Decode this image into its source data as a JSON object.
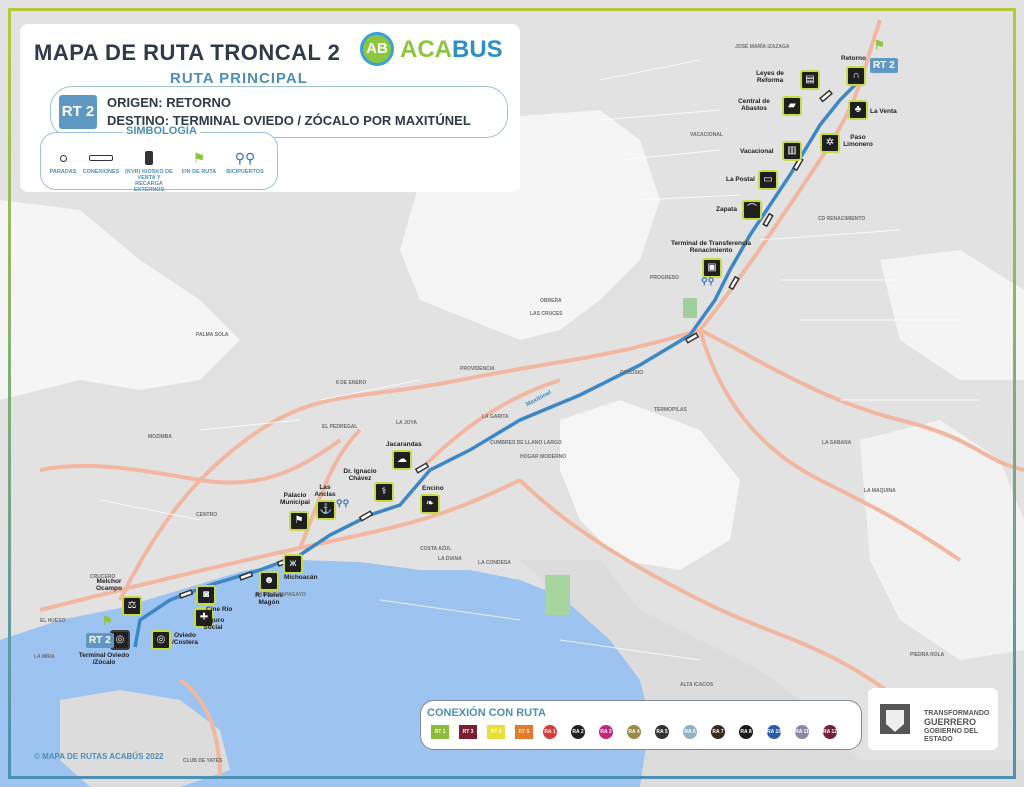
{
  "header": {
    "title": "MAPA DE RUTA TRONCAL 2",
    "logo_mark": "AB",
    "logo_text_a": "ACA",
    "logo_text_b": "BUS",
    "subtitle": "RUTA PRINCIPAL"
  },
  "route": {
    "badge": "RT 2",
    "origin": "ORIGEN: RETORNO",
    "destination": "DESTINO: TERMINAL OVIEDO / ZÓCALO POR MAXITÚNEL"
  },
  "legend": {
    "title": "SIMBOLOGÍA",
    "items": [
      {
        "icon": "stop-dot-icon",
        "label": "PARADAS"
      },
      {
        "icon": "connection-bar-icon",
        "label": "CONEXIONES"
      },
      {
        "icon": "kiosk-icon",
        "label": "(KVR) KIOSKO DE VENTA Y RECARGA EXTERNOS"
      },
      {
        "icon": "flag-icon",
        "label": "FIN DE RUTA"
      },
      {
        "icon": "bicycle-icon",
        "label": "BICIPUERTOS"
      }
    ]
  },
  "stops": [
    {
      "name": "Retorno",
      "icon": "retorno-icon"
    },
    {
      "name": "Leyes de Reforma",
      "icon": "book-icon"
    },
    {
      "name": "Central de Abastos",
      "icon": "truck-icon"
    },
    {
      "name": "La Venta",
      "icon": "tree-icon"
    },
    {
      "name": "Paso Limonero",
      "icon": "wheel-icon"
    },
    {
      "name": "Vacacional",
      "icon": "luggage-icon"
    },
    {
      "name": "La Postal",
      "icon": "postcard-icon"
    },
    {
      "name": "Zapata",
      "icon": "hat-icon"
    },
    {
      "name": "Terminal de Transferencia Renacimiento",
      "icon": "bus-terminal-icon"
    },
    {
      "name": "Jacarandas",
      "icon": "tree-icon"
    },
    {
      "name": "Encino",
      "icon": "leaf-icon"
    },
    {
      "name": "Dr. Ignacio Chávez",
      "icon": "stethoscope-icon"
    },
    {
      "name": "Las Anclas",
      "icon": "anchor-icon"
    },
    {
      "name": "Palacio Municipal",
      "icon": "flag-building-icon"
    },
    {
      "name": "Michoacán",
      "icon": "butterfly-icon"
    },
    {
      "name": "R. Flores Magón",
      "icon": "person-icon"
    },
    {
      "name": "Cine Río",
      "icon": "camera-icon"
    },
    {
      "name": "Seguro Social",
      "icon": "health-icon"
    },
    {
      "name": "Melchor Ocampo",
      "icon": "scales-icon"
    },
    {
      "name": "Oviedo /Costera",
      "icon": "target-icon"
    },
    {
      "name": "Terminal Oviedo /Zócalo",
      "icon": "target-icon"
    }
  ],
  "end_tags": [
    "RT 2",
    "RT 2"
  ],
  "neighborhoods": [
    "JOSÉ MARÍA IZAZAGA",
    "VACACIONAL",
    "CD RENACIMIENTO",
    "PROGRESO",
    "OBRERA",
    "LAS CRUCES",
    "PALMA SOLA",
    "6 DE ENERO",
    "PROVIDENCIA",
    "LA GARITA",
    "CUMBRES DE LLANO LARGO",
    "COLOSIO",
    "HOGAR MODERNO",
    "COSTA AZUL",
    "LA CONDESA",
    "MOZIMBA",
    "LA MIRA",
    "EL PEDREGAL",
    "LA JOYA",
    "LA DIANA",
    "TERMOPILAS",
    "LA SABANA",
    "LA MAQUINA",
    "CENTRO",
    "CRUCERO",
    "EL HUESO",
    "PIEDRA ROLA",
    "ALTA ICACOS",
    "PARQUE PAPAGAYO",
    "CLUB DE YATES"
  ],
  "connections": {
    "title": "CONEXIÓN CON RUTA",
    "routes": [
      {
        "code": "RT 1",
        "color": "#8dbb3c"
      },
      {
        "code": "RT 3",
        "color": "#7a2036"
      },
      {
        "code": "RT 4",
        "color": "#e8df3e"
      },
      {
        "code": "RT 5",
        "color": "#e57a2a"
      },
      {
        "code": "RA 1",
        "color": "#d93a3a"
      },
      {
        "code": "RA 2",
        "color": "#222222"
      },
      {
        "code": "RA 3",
        "color": "#c2267d"
      },
      {
        "code": "RA 4",
        "color": "#9a8a44"
      },
      {
        "code": "RA 5",
        "color": "#333333"
      },
      {
        "code": "RA 6",
        "color": "#8fb3c8"
      },
      {
        "code": "RA 7",
        "color": "#3a2a1a"
      },
      {
        "code": "RA 8",
        "color": "#1a1a1a"
      },
      {
        "code": "RA 10",
        "color": "#2b5aa8"
      },
      {
        "code": "RA 11",
        "color": "#8a88a8"
      },
      {
        "code": "RA 12",
        "color": "#7a1f3a"
      }
    ]
  },
  "road_label": "Maxitúnel",
  "government": {
    "line1": "TRANSFORMANDO",
    "line2": "GUERRERO",
    "line3": "GOBIERNO DEL ESTADO"
  },
  "copyright": "© MAPA DE RUTAS ACABÚS 2022",
  "colors": {
    "route": "#3d88c4",
    "land": "#dcdcdc",
    "water": "#9dc3f0",
    "roads": "#f4b8a0",
    "accent": "#c7d944"
  }
}
